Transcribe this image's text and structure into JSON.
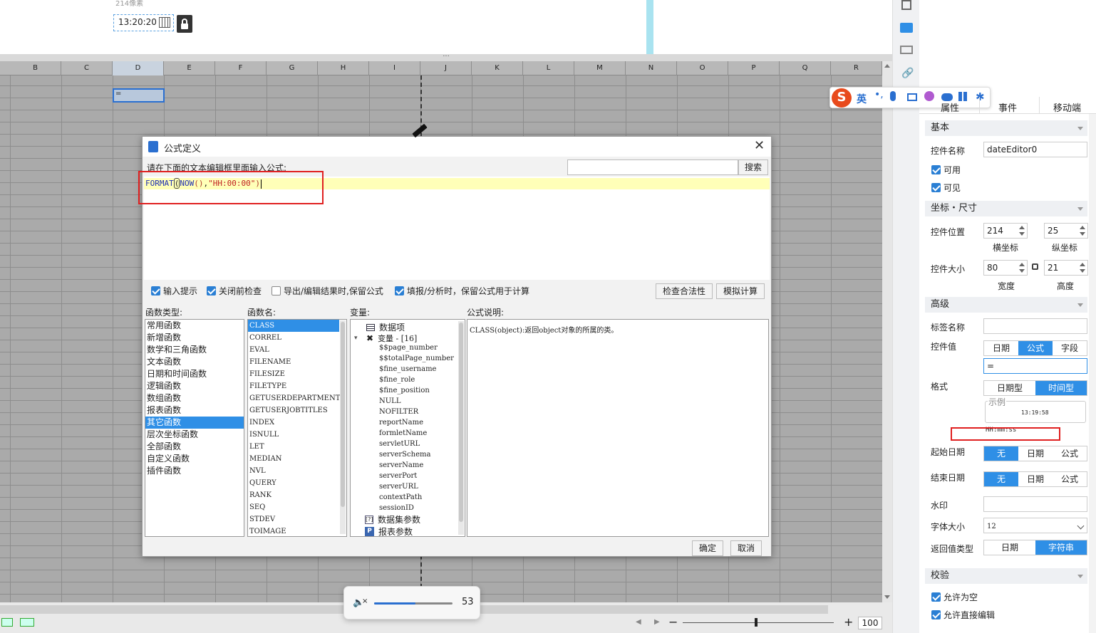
{
  "design": {
    "pixel_hint": "214像素",
    "time_value": "13:20:20"
  },
  "sheet": {
    "columns": [
      "B",
      "C",
      "D",
      "E",
      "F",
      "G",
      "H",
      "I",
      "J",
      "K",
      "L",
      "M",
      "N",
      "O",
      "P",
      "Q",
      "R"
    ],
    "selected_cell_value": "=",
    "zoom": "100"
  },
  "dialog": {
    "title": "公式定义",
    "prompt": "请在下面的文本编辑框里面输入公式:",
    "search_button": "搜索",
    "formula": {
      "fn": "FORMAT",
      "paren_open": "(",
      "now": "NOW",
      "call": "()",
      "comma": ",",
      "str": "\"HH:00:00\"",
      "paren_close": ")"
    },
    "options": [
      {
        "label": "输入提示",
        "checked": true
      },
      {
        "label": "关闭前检查",
        "checked": true
      },
      {
        "label": "导出/编辑结果时,保留公式",
        "checked": false
      },
      {
        "label": "填报/分析时，保留公式用于计算",
        "checked": true
      }
    ],
    "check_button": "检查合法性",
    "simulate_button": "模拟计算",
    "fn_type_header": "函数类型:",
    "fn_name_header": "函数名:",
    "var_header": "变量:",
    "desc_header": "公式说明:",
    "fn_types": [
      "常用函数",
      "新增函数",
      "数学和三角函数",
      "文本函数",
      "日期和时间函数",
      "逻辑函数",
      "数组函数",
      "报表函数",
      "其它函数",
      "层次坐标函数",
      "全部函数",
      "自定义函数",
      "插件函数"
    ],
    "fn_types_selected": 8,
    "fn_names": [
      "CLASS",
      "CORREL",
      "EVAL",
      "FILENAME",
      "FILESIZE",
      "FILETYPE",
      "GETUSERDEPARTMENTS",
      "GETUSERJOBTITLES",
      "INDEX",
      "ISNULL",
      "LET",
      "MEDIAN",
      "NVL",
      "QUERY",
      "RANK",
      "SEQ",
      "STDEV",
      "TOIMAGE"
    ],
    "fn_names_selected": 0,
    "vars": {
      "data_item": "数据项",
      "var_group": "变量 - [16]",
      "items": [
        "$$page_number",
        "$$totalPage_number",
        "$fine_username",
        "$fine_role",
        "$fine_position",
        "NULL",
        "NOFILTER",
        "reportName",
        "formletName",
        "servletURL",
        "serverSchema",
        "serverName",
        "serverPort",
        "serverURL",
        "contextPath",
        "sessionID"
      ],
      "dataset_params": "数据集参数",
      "report_params": "报表参数"
    },
    "description": "CLASS(object):返回object对象的所属的类。",
    "ok_button": "确定",
    "cancel_button": "取消"
  },
  "volume": {
    "value": "53",
    "level": 0.53
  },
  "ime": {
    "lang": "英"
  },
  "panel": {
    "tabs": [
      "属性",
      "事件",
      "移动端"
    ],
    "basic": {
      "header": "基本",
      "name_label": "控件名称",
      "name_value": "dateEditor0",
      "enabled": "可用",
      "visible": "可见"
    },
    "geometry": {
      "header": "坐标・尺寸",
      "pos_label": "控件位置",
      "x": "214",
      "y": "25",
      "x_label": "横坐标",
      "y_label": "纵坐标",
      "size_label": "控件大小",
      "w": "80",
      "h": "21",
      "w_label": "宽度",
      "h_label": "高度"
    },
    "advanced": {
      "header": "高级",
      "tag_label": "标签名称",
      "value_label": "控件值",
      "value_opts": [
        "日期",
        "公式",
        "字段"
      ],
      "value_sel": 1,
      "value_formula": "=",
      "format_label": "格式",
      "format_opts": [
        "日期型",
        "时间型"
      ],
      "format_sel": 1,
      "sample_label": "示例",
      "sample_value": "13:19:58",
      "format_pattern": "HH:mm:ss",
      "start_label": "起始日期",
      "end_label": "结束日期",
      "range_opts": [
        "无",
        "日期",
        "公式"
      ],
      "watermark_label": "水印",
      "font_label": "字体大小",
      "font_value": "12",
      "return_label": "返回值类型",
      "return_opts": [
        "日期",
        "字符串"
      ],
      "return_sel": 1
    },
    "validation": {
      "header": "校验",
      "allow_empty": "允许为空",
      "allow_edit": "允许直接编辑"
    }
  }
}
